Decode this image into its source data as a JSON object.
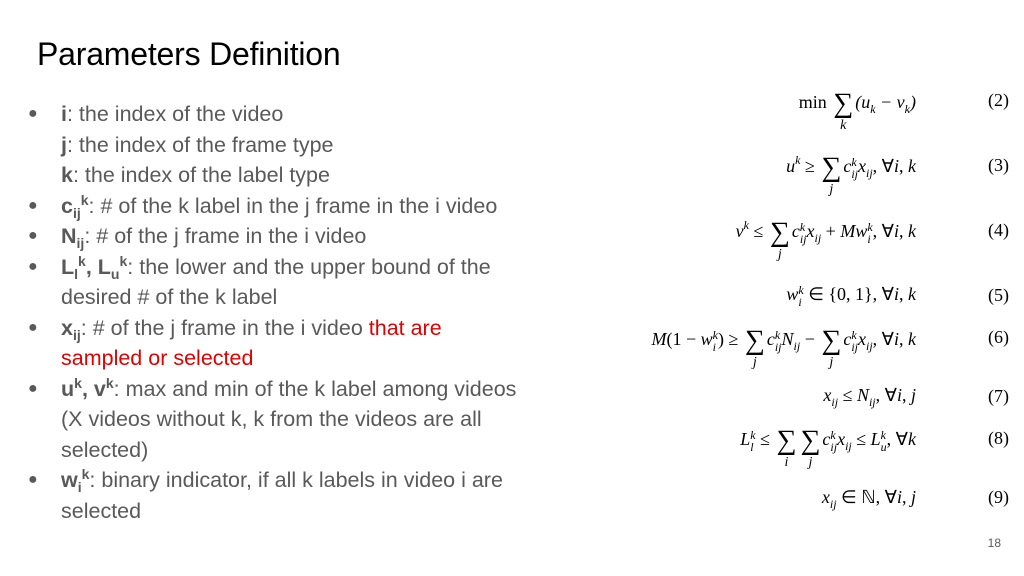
{
  "slide": {
    "title": "Parameters Definition",
    "page_number": "18",
    "accent_color": "#e00000",
    "text_color": "#595959"
  },
  "bullets": [
    {
      "lines": [
        {
          "sym": "i",
          "text": ": the index of the video"
        },
        {
          "sym": "j",
          "text": ": the index of the frame type"
        },
        {
          "sym": "k",
          "text": ": the index of the label type"
        }
      ]
    },
    {
      "sym": "c",
      "sub": "ij",
      "sup": "k",
      "text": ": # of the k label in the j frame in the i video"
    },
    {
      "sym": "N",
      "sub": "ij",
      "text": ": # of the j frame in the i video"
    },
    {
      "sym1": "L",
      "sub1": "l",
      "sup1": "k",
      "sep": ", ",
      "sym2": "L",
      "sub2": "u",
      "sup2": "k",
      "text": ": the lower and the upper bound of the desired # of the k label"
    },
    {
      "sym": "x",
      "sub": "ij",
      "text": ": # of the j frame in the i video ",
      "highlight": "that are sampled or selected"
    },
    {
      "sym1": "u",
      "sup1": "k",
      "sep": ", ",
      "sym2": "v",
      "sup2": "k",
      "text": ": max and min of the k label among videos (X videos without k, k from the videos are all selected)"
    },
    {
      "sym": "w",
      "sub": "i",
      "sup": "k",
      "text": ": binary indicator, if all k labels in video i are selected"
    }
  ],
  "equations": [
    {
      "number": "(2)",
      "latex": "min Σ_k (u_k − v_k)"
    },
    {
      "number": "(3)",
      "latex": "u^k ≥ Σ_j c_ij^k x_ij, ∀i, k"
    },
    {
      "number": "(4)",
      "latex": "v^k ≤ Σ_j c_ij^k x_ij + M w_i^k, ∀i, k"
    },
    {
      "number": "(5)",
      "latex": "w_i^k ∈ {0, 1}, ∀i, k"
    },
    {
      "number": "(6)",
      "latex": "M(1 − w_i^k) ≥ Σ_j c_ij^k N_ij − Σ_j c_ij^k x_ij, ∀i, k"
    },
    {
      "number": "(7)",
      "latex": "x_ij ≤ N_ij, ∀i, j"
    },
    {
      "number": "(8)",
      "latex": "L_l^k ≤ Σ_i Σ_j c_ij^k x_ij ≤ L_u^k, ∀k"
    },
    {
      "number": "(9)",
      "latex": "x_ij ∈ ℕ, ∀i, j"
    }
  ],
  "eqtext": {
    "min": "min",
    "sigma": "∑",
    "k": "k",
    "j": "j",
    "i": "i",
    "e2": "(u<sub>k</sub> − v<sub>k</sub>)",
    "e3_lhs": "u<sup>k</sup> ≥",
    "e3_rhs": ", ∀i, k",
    "e4_lhs": "v<sup>k</sup> ≤",
    "e4_rhs": " + Mw, ∀i, k",
    "e5": "∈ {0, 1}, ∀i, k",
    "e6_lhs": "M(1 − w) ≥",
    "e7": "≤ N, ∀i, j",
    "e8_tail": "≤ L, ∀k",
    "e9": "∈ ℕ, ∀i, j"
  }
}
